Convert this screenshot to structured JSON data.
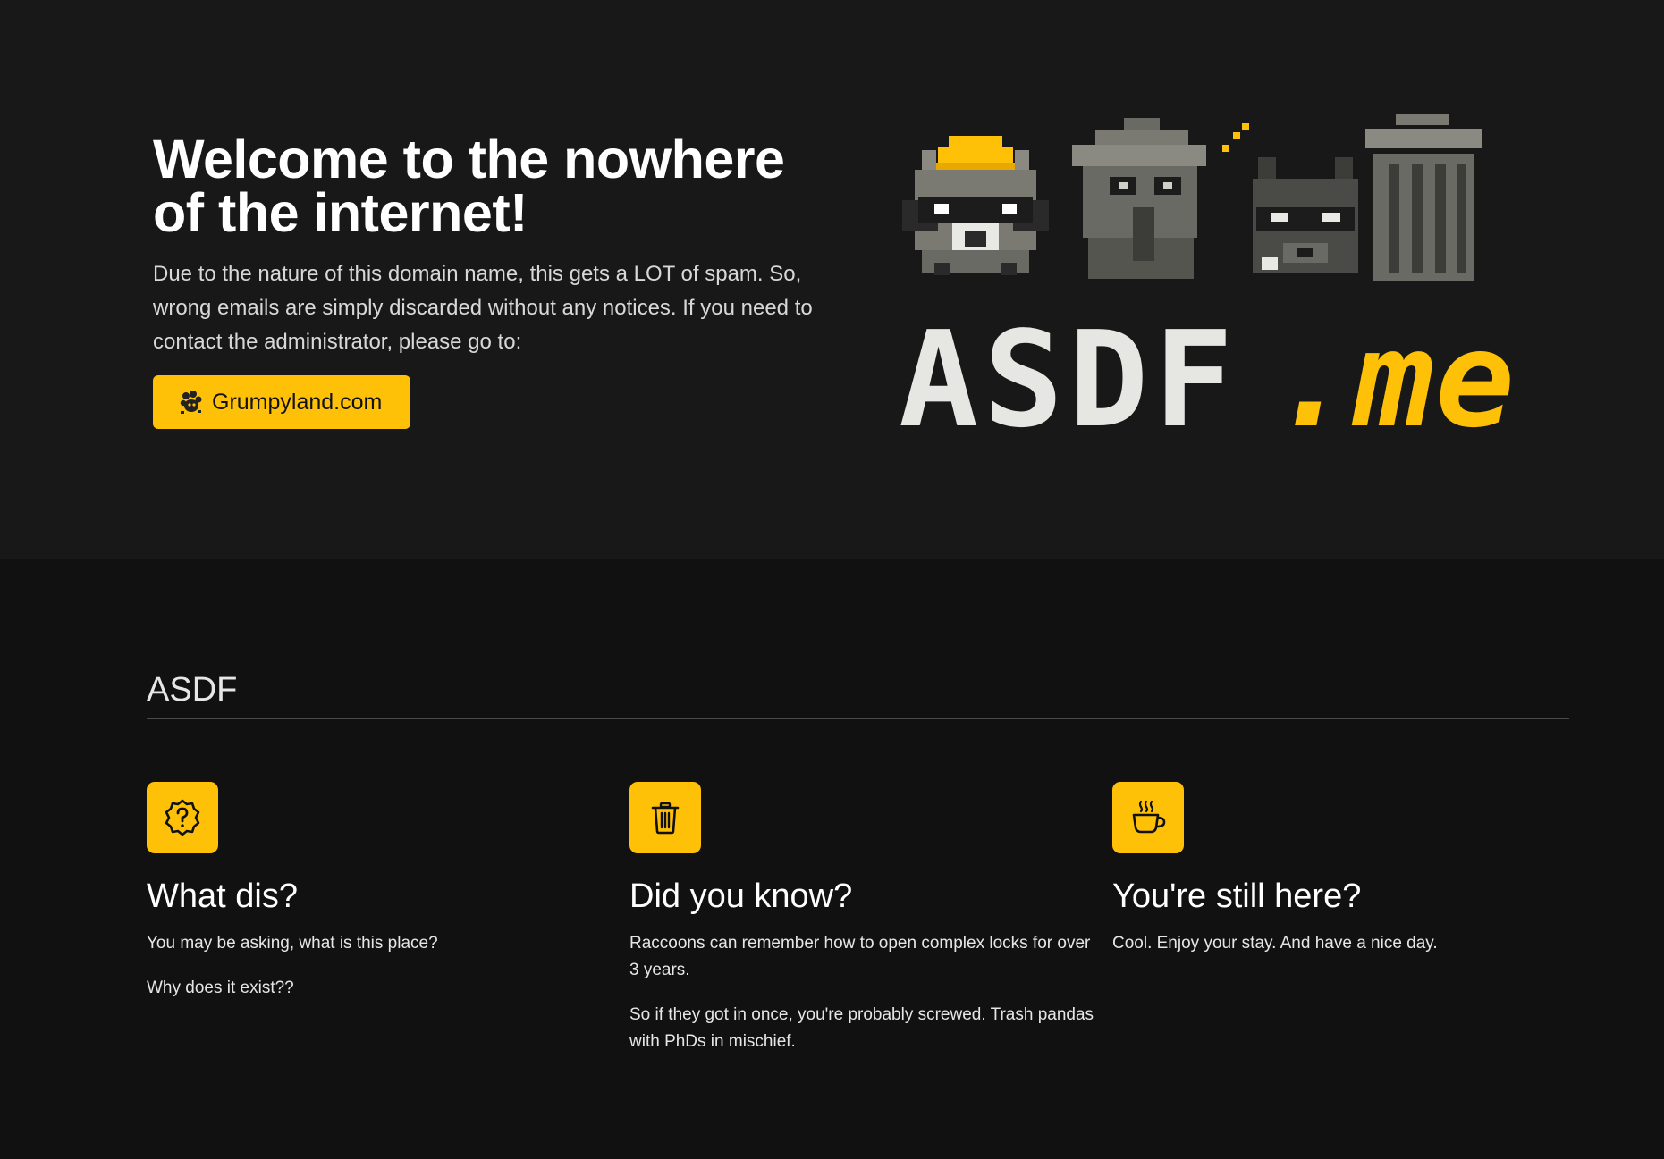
{
  "hero": {
    "title": "Welcome to the nowhere of the internet!",
    "description": "Due to the nature of this domain name, this gets a LOT of spam. So, wrong emails are simply discarded without any notices. If you need to contact the administrator, please go to:",
    "cta_label": "Grumpyland.com",
    "cta_icon": "raccoon-paw-icon"
  },
  "logo": {
    "text_main": "ASDF",
    "text_tld": ".me",
    "characters": [
      "raccoon-with-hat",
      "trash-raccoon",
      "sneaky-raccoon",
      "trash-can"
    ]
  },
  "section": {
    "title": "ASDF"
  },
  "features": [
    {
      "icon": "question-badge-icon",
      "title": "What dis?",
      "paragraphs": [
        "You may be asking, what is this place?",
        "Why does it exist??"
      ]
    },
    {
      "icon": "trash-icon",
      "title": "Did you know?",
      "paragraphs": [
        "Raccoons can remember how to open complex locks for over 3 years.",
        "So if they got in once, you're probably screwed. Trash pandas with PhDs in mischief."
      ]
    },
    {
      "icon": "coffee-cup-icon",
      "title": "You're still here?",
      "paragraphs": [
        "Cool. Enjoy your stay. And have a nice day."
      ]
    }
  ],
  "colors": {
    "accent": "#ffc107",
    "hero_bg": "#181818",
    "page_bg": "#111111",
    "logo_text": "#e6e6e2",
    "raccoon_gray": "#7a7a72"
  }
}
